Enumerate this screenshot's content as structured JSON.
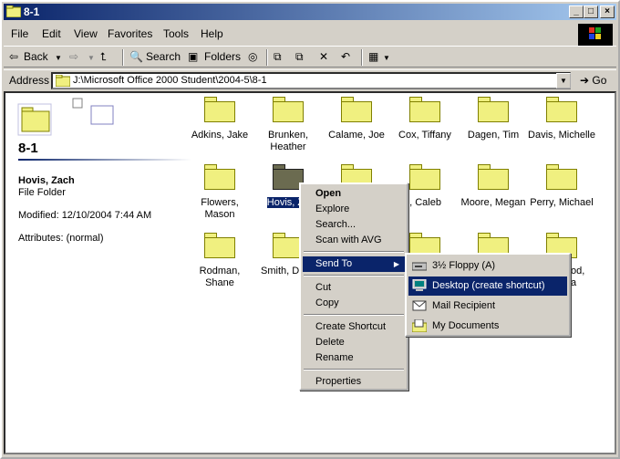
{
  "window": {
    "title": "8-1"
  },
  "menu": [
    "File",
    "Edit",
    "View",
    "Favorites",
    "Tools",
    "Help"
  ],
  "toolbar": {
    "back": "Back",
    "search": "Search",
    "folders": "Folders"
  },
  "address": {
    "label": "Address",
    "value": "J:\\Microsoft Office 2000 Student\\2004-5\\8-1",
    "go": "Go"
  },
  "left_panel": {
    "folder_title": "8-1",
    "selected_name": "Hovis, Zach",
    "selected_type": "File Folder",
    "modified": "Modified: 12/10/2004 7:44 AM",
    "attributes": "Attributes: (normal)"
  },
  "folders": [
    {
      "line1": "Adkins, Jake",
      "line2": ""
    },
    {
      "line1": "Brunken,",
      "line2": "Heather"
    },
    {
      "line1": "Calame, Joe",
      "line2": ""
    },
    {
      "line1": "Cox, Tiffany",
      "line2": ""
    },
    {
      "line1": "Dagen, Tim",
      "line2": ""
    },
    {
      "line1": "Davis, Michelle",
      "line2": ""
    },
    {
      "line1": "Flowers,",
      "line2": "Mason"
    },
    {
      "line1": "Hovis, Za",
      "line2": ""
    },
    {
      "line1": "hell, Caleb",
      "line2": ""
    },
    {
      "line1": "Moore, Megan",
      "line2": ""
    },
    {
      "line1": "Perry, Michael",
      "line2": ""
    },
    {
      "line1": "Rodman,",
      "line2": "Shane"
    },
    {
      "line1": "Smith, Dr",
      "line2": ""
    },
    {
      "line1": "od,",
      "line2": "a"
    }
  ],
  "context_menu": {
    "open": "Open",
    "explore": "Explore",
    "search": "Search...",
    "scan": "Scan with AVG",
    "send_to": "Send To",
    "cut": "Cut",
    "copy": "Copy",
    "create_shortcut": "Create Shortcut",
    "delete": "Delete",
    "rename": "Rename",
    "properties": "Properties"
  },
  "send_to_menu": {
    "floppy": "3½ Floppy (A)",
    "desktop": "Desktop (create shortcut)",
    "mail": "Mail Recipient",
    "docs": "My Documents"
  }
}
